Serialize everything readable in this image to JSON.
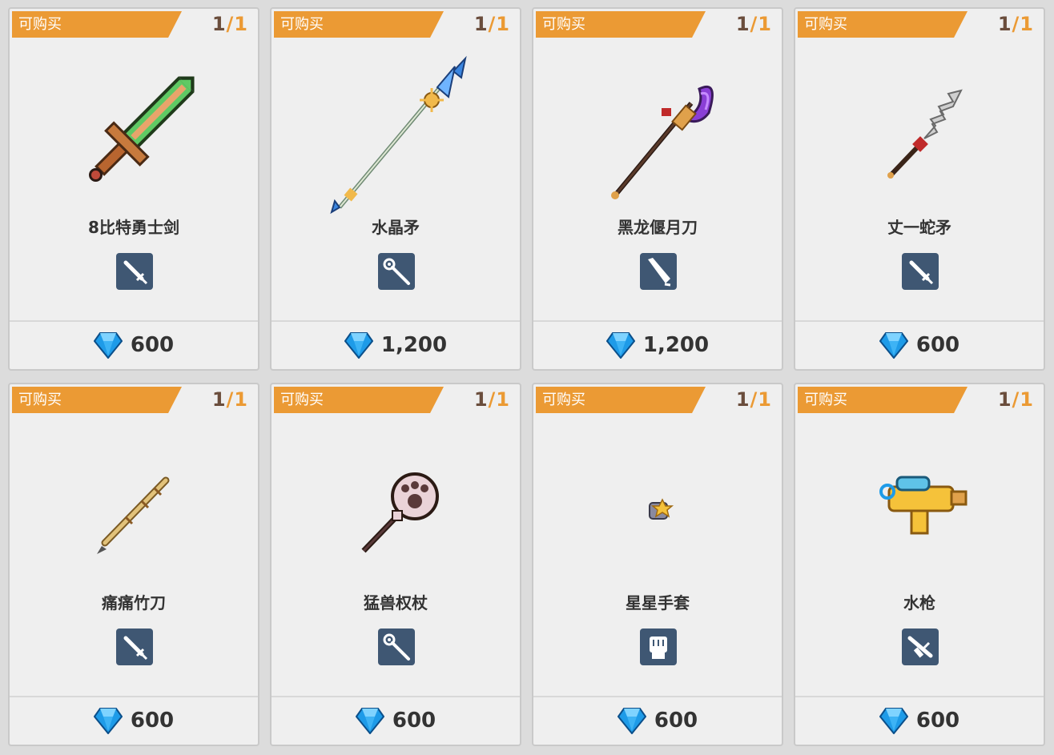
{
  "shop": {
    "items": [
      {
        "tag": "可购买",
        "stock_current": "1",
        "stock_sep": "/",
        "stock_max": "1",
        "name": "8比特勇士剑",
        "price": "600",
        "weapon_type_icon": "sword-type-icon",
        "art_icon": "green-pixel-sword-icon"
      },
      {
        "tag": "可购买",
        "stock_current": "1",
        "stock_sep": "/",
        "stock_max": "1",
        "name": "水晶矛",
        "price": "1,200",
        "weapon_type_icon": "staff-type-icon",
        "art_icon": "crystal-spear-icon"
      },
      {
        "tag": "可购买",
        "stock_current": "1",
        "stock_sep": "/",
        "stock_max": "1",
        "name": "黑龙偃月刀",
        "price": "1,200",
        "weapon_type_icon": "blade-type-icon",
        "art_icon": "purple-glaive-icon"
      },
      {
        "tag": "可购买",
        "stock_current": "1",
        "stock_sep": "/",
        "stock_max": "1",
        "name": "丈一蛇矛",
        "price": "600",
        "weapon_type_icon": "sword-type-icon",
        "art_icon": "serpent-spear-icon"
      },
      {
        "tag": "可购买",
        "stock_current": "1",
        "stock_sep": "/",
        "stock_max": "1",
        "name": "痛痛竹刀",
        "price": "600",
        "weapon_type_icon": "sword-type-icon",
        "art_icon": "bamboo-sword-icon"
      },
      {
        "tag": "可购买",
        "stock_current": "1",
        "stock_sep": "/",
        "stock_max": "1",
        "name": "猛兽权杖",
        "price": "600",
        "weapon_type_icon": "staff-type-icon",
        "art_icon": "paw-scepter-icon"
      },
      {
        "tag": "可购买",
        "stock_current": "1",
        "stock_sep": "/",
        "stock_max": "1",
        "name": "星星手套",
        "price": "600",
        "weapon_type_icon": "fist-type-icon",
        "art_icon": "star-glove-icon"
      },
      {
        "tag": "可购买",
        "stock_current": "1",
        "stock_sep": "/",
        "stock_max": "1",
        "name": "水枪",
        "price": "600",
        "weapon_type_icon": "gun-type-icon",
        "art_icon": "water-gun-icon"
      }
    ],
    "currency_icon": "blue-gem-icon",
    "colors": {
      "tag_bg": "#eb9a34",
      "stock_current": "#6a4d3c",
      "type_icon_bg": "#3f5773",
      "gem": "#1e9be8"
    }
  }
}
